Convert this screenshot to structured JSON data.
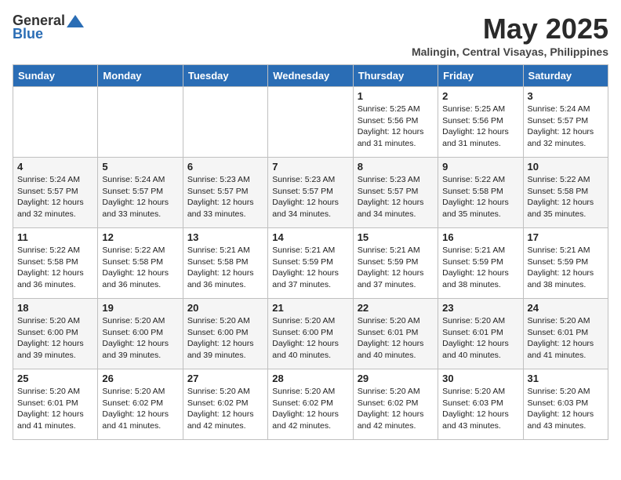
{
  "header": {
    "logo_general": "General",
    "logo_blue": "Blue",
    "month_title": "May 2025",
    "location": "Malingin, Central Visayas, Philippines"
  },
  "days_of_week": [
    "Sunday",
    "Monday",
    "Tuesday",
    "Wednesday",
    "Thursday",
    "Friday",
    "Saturday"
  ],
  "weeks": [
    [
      {
        "day": "",
        "detail": ""
      },
      {
        "day": "",
        "detail": ""
      },
      {
        "day": "",
        "detail": ""
      },
      {
        "day": "",
        "detail": ""
      },
      {
        "day": "1",
        "detail": "Sunrise: 5:25 AM\nSunset: 5:56 PM\nDaylight: 12 hours\nand 31 minutes."
      },
      {
        "day": "2",
        "detail": "Sunrise: 5:25 AM\nSunset: 5:56 PM\nDaylight: 12 hours\nand 31 minutes."
      },
      {
        "day": "3",
        "detail": "Sunrise: 5:24 AM\nSunset: 5:57 PM\nDaylight: 12 hours\nand 32 minutes."
      }
    ],
    [
      {
        "day": "4",
        "detail": "Sunrise: 5:24 AM\nSunset: 5:57 PM\nDaylight: 12 hours\nand 32 minutes."
      },
      {
        "day": "5",
        "detail": "Sunrise: 5:24 AM\nSunset: 5:57 PM\nDaylight: 12 hours\nand 33 minutes."
      },
      {
        "day": "6",
        "detail": "Sunrise: 5:23 AM\nSunset: 5:57 PM\nDaylight: 12 hours\nand 33 minutes."
      },
      {
        "day": "7",
        "detail": "Sunrise: 5:23 AM\nSunset: 5:57 PM\nDaylight: 12 hours\nand 34 minutes."
      },
      {
        "day": "8",
        "detail": "Sunrise: 5:23 AM\nSunset: 5:57 PM\nDaylight: 12 hours\nand 34 minutes."
      },
      {
        "day": "9",
        "detail": "Sunrise: 5:22 AM\nSunset: 5:58 PM\nDaylight: 12 hours\nand 35 minutes."
      },
      {
        "day": "10",
        "detail": "Sunrise: 5:22 AM\nSunset: 5:58 PM\nDaylight: 12 hours\nand 35 minutes."
      }
    ],
    [
      {
        "day": "11",
        "detail": "Sunrise: 5:22 AM\nSunset: 5:58 PM\nDaylight: 12 hours\nand 36 minutes."
      },
      {
        "day": "12",
        "detail": "Sunrise: 5:22 AM\nSunset: 5:58 PM\nDaylight: 12 hours\nand 36 minutes."
      },
      {
        "day": "13",
        "detail": "Sunrise: 5:21 AM\nSunset: 5:58 PM\nDaylight: 12 hours\nand 36 minutes."
      },
      {
        "day": "14",
        "detail": "Sunrise: 5:21 AM\nSunset: 5:59 PM\nDaylight: 12 hours\nand 37 minutes."
      },
      {
        "day": "15",
        "detail": "Sunrise: 5:21 AM\nSunset: 5:59 PM\nDaylight: 12 hours\nand 37 minutes."
      },
      {
        "day": "16",
        "detail": "Sunrise: 5:21 AM\nSunset: 5:59 PM\nDaylight: 12 hours\nand 38 minutes."
      },
      {
        "day": "17",
        "detail": "Sunrise: 5:21 AM\nSunset: 5:59 PM\nDaylight: 12 hours\nand 38 minutes."
      }
    ],
    [
      {
        "day": "18",
        "detail": "Sunrise: 5:20 AM\nSunset: 6:00 PM\nDaylight: 12 hours\nand 39 minutes."
      },
      {
        "day": "19",
        "detail": "Sunrise: 5:20 AM\nSunset: 6:00 PM\nDaylight: 12 hours\nand 39 minutes."
      },
      {
        "day": "20",
        "detail": "Sunrise: 5:20 AM\nSunset: 6:00 PM\nDaylight: 12 hours\nand 39 minutes."
      },
      {
        "day": "21",
        "detail": "Sunrise: 5:20 AM\nSunset: 6:00 PM\nDaylight: 12 hours\nand 40 minutes."
      },
      {
        "day": "22",
        "detail": "Sunrise: 5:20 AM\nSunset: 6:01 PM\nDaylight: 12 hours\nand 40 minutes."
      },
      {
        "day": "23",
        "detail": "Sunrise: 5:20 AM\nSunset: 6:01 PM\nDaylight: 12 hours\nand 40 minutes."
      },
      {
        "day": "24",
        "detail": "Sunrise: 5:20 AM\nSunset: 6:01 PM\nDaylight: 12 hours\nand 41 minutes."
      }
    ],
    [
      {
        "day": "25",
        "detail": "Sunrise: 5:20 AM\nSunset: 6:01 PM\nDaylight: 12 hours\nand 41 minutes."
      },
      {
        "day": "26",
        "detail": "Sunrise: 5:20 AM\nSunset: 6:02 PM\nDaylight: 12 hours\nand 41 minutes."
      },
      {
        "day": "27",
        "detail": "Sunrise: 5:20 AM\nSunset: 6:02 PM\nDaylight: 12 hours\nand 42 minutes."
      },
      {
        "day": "28",
        "detail": "Sunrise: 5:20 AM\nSunset: 6:02 PM\nDaylight: 12 hours\nand 42 minutes."
      },
      {
        "day": "29",
        "detail": "Sunrise: 5:20 AM\nSunset: 6:02 PM\nDaylight: 12 hours\nand 42 minutes."
      },
      {
        "day": "30",
        "detail": "Sunrise: 5:20 AM\nSunset: 6:03 PM\nDaylight: 12 hours\nand 43 minutes."
      },
      {
        "day": "31",
        "detail": "Sunrise: 5:20 AM\nSunset: 6:03 PM\nDaylight: 12 hours\nand 43 minutes."
      }
    ]
  ]
}
